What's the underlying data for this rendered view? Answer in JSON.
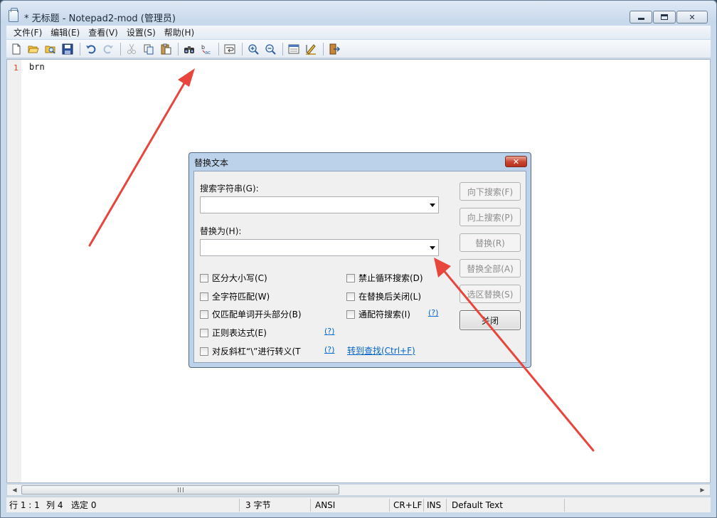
{
  "window": {
    "title": "* 无标题 - Notepad2-mod (管理员)"
  },
  "menu": [
    "文件(F)",
    "编辑(E)",
    "查看(V)",
    "设置(S)",
    "帮助(H)"
  ],
  "toolbar": {
    "buttons": [
      "new-file",
      "open-file",
      "browse",
      "save",
      "undo",
      "redo",
      "cut",
      "copy",
      "paste",
      "find",
      "replace",
      "word-wrap",
      "zoom-in",
      "zoom-out",
      "scheme",
      "customize-schemes",
      "exit"
    ]
  },
  "editor": {
    "line_number": "1",
    "line_text": "brn"
  },
  "status": {
    "position": "行 1 : 1",
    "column": "列 4",
    "selection": "选定 0",
    "size": "3 字节",
    "encoding": "ANSI",
    "line_endings": "CR+LF",
    "insert_mode": "INS",
    "scheme": "Default Text"
  },
  "dialog": {
    "title": "替换文本",
    "close_glyph": "✕",
    "search_label": "搜索字符串(G):",
    "search_value": "",
    "replace_label": "替换为(H):",
    "replace_value": "",
    "checkboxes": {
      "match_case": "区分大小写(C)",
      "whole_word": "全字符匹配(W)",
      "word_start": "仅匹配单词开头部分(B)",
      "regex": "正则表达式(E)",
      "backslash": "对反斜杠“\\”进行转义(T",
      "no_wrap": "禁止循环搜索(D)",
      "close_after": "在替换后关闭(L)",
      "wildcard": "通配符搜索(I)"
    },
    "help_link": "(?)",
    "goto_find": "转到查找(Ctrl+F)",
    "buttons": {
      "find_next": "向下搜索(F)",
      "find_prev": "向上搜索(P)",
      "replace": "替换(R)",
      "replace_all": "替换全部(A)",
      "replace_selection": "选区替换(S)",
      "close": "关闭"
    }
  },
  "colors": {
    "accent_link": "#0066cc",
    "line_number": "#e03c1e",
    "annotation_arrow": "#e8453c"
  }
}
